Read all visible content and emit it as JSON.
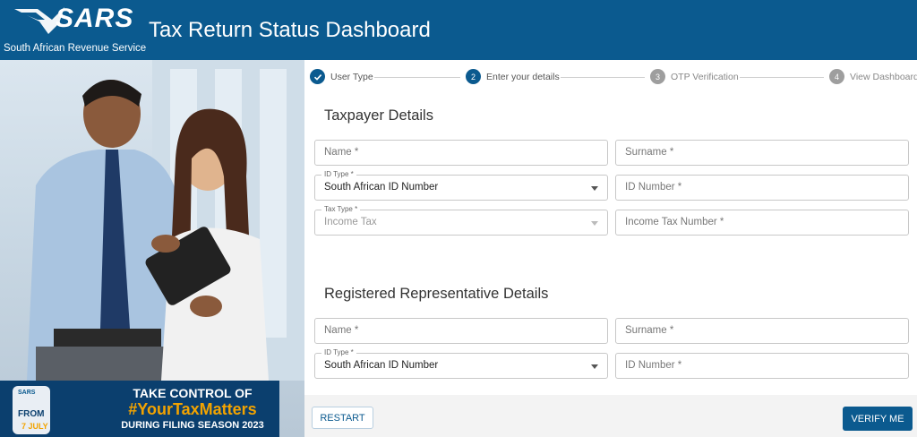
{
  "header": {
    "logo_text": "SARS",
    "logo_subtitle": "South African Revenue Service",
    "title": "Tax Return Status Dashboard"
  },
  "banner": {
    "phone_logo": "SARS",
    "from": "FROM",
    "date": "7 JULY",
    "line1": "TAKE CONTROL OF",
    "line2": "#YourTaxMatters",
    "line3": "DURING FILING SEASON 2023"
  },
  "stepper": {
    "steps": [
      {
        "label": "User Type",
        "state": "done",
        "number": "✓"
      },
      {
        "label": "Enter your details",
        "state": "active",
        "number": "2"
      },
      {
        "label": "OTP Verification",
        "state": "pending",
        "number": "3"
      },
      {
        "label": "View Dashboard",
        "state": "pending",
        "number": "4"
      }
    ]
  },
  "taxpayer": {
    "title": "Taxpayer Details",
    "name_placeholder": "Name *",
    "surname_placeholder": "Surname *",
    "id_type_label": "ID Type *",
    "id_type_value": "South African ID Number",
    "id_number_placeholder": "ID Number *",
    "tax_type_label": "Tax Type *",
    "tax_type_value": "Income Tax",
    "income_tax_number_placeholder": "Income Tax Number *"
  },
  "representative": {
    "title": "Registered Representative Details",
    "name_placeholder": "Name *",
    "surname_placeholder": "Surname *",
    "id_type_label": "ID Type *",
    "id_type_value": "South African ID Number",
    "id_number_placeholder": "ID Number *"
  },
  "actions": {
    "restart_label": "RESTART",
    "verify_label": "VERIFY ME"
  },
  "colors": {
    "primary": "#0b5a8f",
    "banner_bg": "#0b3f6e",
    "accent": "#f2a300"
  }
}
